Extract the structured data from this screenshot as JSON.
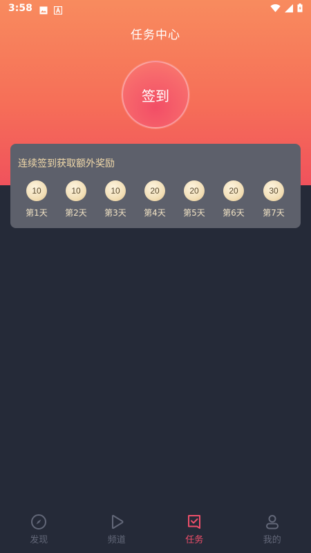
{
  "status_bar": {
    "time": "3:58"
  },
  "header": {
    "title": "任务中心"
  },
  "checkin": {
    "button_label": "签到"
  },
  "reward_card": {
    "title": "连续签到获取额外奖励",
    "days": [
      {
        "coins": "10",
        "label": "第1天"
      },
      {
        "coins": "10",
        "label": "第2天"
      },
      {
        "coins": "10",
        "label": "第3天"
      },
      {
        "coins": "20",
        "label": "第4天"
      },
      {
        "coins": "20",
        "label": "第5天"
      },
      {
        "coins": "20",
        "label": "第6天"
      },
      {
        "coins": "30",
        "label": "第7天"
      }
    ]
  },
  "tab_bar": {
    "items": [
      {
        "label": "发现",
        "icon": "compass-icon",
        "active": false
      },
      {
        "label": "频道",
        "icon": "play-icon",
        "active": false
      },
      {
        "label": "任务",
        "icon": "task-check-icon",
        "active": true
      },
      {
        "label": "我的",
        "icon": "user-icon",
        "active": false
      }
    ]
  },
  "colors": {
    "background": "#252a38",
    "accent": "#ef4f6a",
    "gold_text": "#f1d9a9",
    "card": "#5d606b",
    "inactive_tab": "#636879"
  }
}
